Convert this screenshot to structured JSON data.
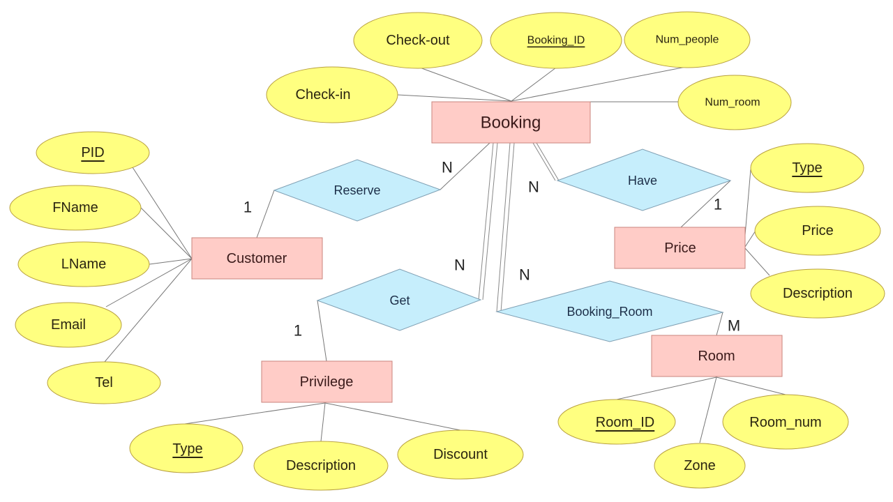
{
  "entities": {
    "booking": "Booking",
    "customer": "Customer",
    "price": "Price",
    "privilege": "Privilege",
    "room": "Room"
  },
  "relationships": {
    "reserve": "Reserve",
    "have": "Have",
    "get": "Get",
    "booking_room": "Booking_Room"
  },
  "attributes": {
    "booking": {
      "check_out": "Check-out",
      "booking_id": "Booking_ID",
      "num_people": "Num_people",
      "check_in": "Check-in",
      "num_room": "Num_room"
    },
    "customer": {
      "pid": "PID",
      "fname": "FName",
      "lname": "LName",
      "email": "Email",
      "tel": "Tel"
    },
    "price": {
      "type": "Type",
      "price": "Price",
      "description": "Description"
    },
    "privilege": {
      "type": "Type",
      "description": "Description",
      "discount": "Discount"
    },
    "room": {
      "room_id": "Room_ID",
      "zone": "Zone",
      "room_num": "Room_num"
    }
  },
  "cardinalities": {
    "reserve_booking": "N",
    "reserve_customer": "1",
    "have_booking": "N",
    "have_price": "1",
    "get_booking": "N",
    "get_privilege": "1",
    "booking_room_booking": "N",
    "booking_room_room": "M"
  },
  "primary_keys": [
    "Booking_ID",
    "PID",
    "Type",
    "Room_ID"
  ],
  "colors": {
    "entity_fill": "#ffccc7",
    "attribute_fill": "#ffff80",
    "relationship_fill": "#c6eefc"
  }
}
